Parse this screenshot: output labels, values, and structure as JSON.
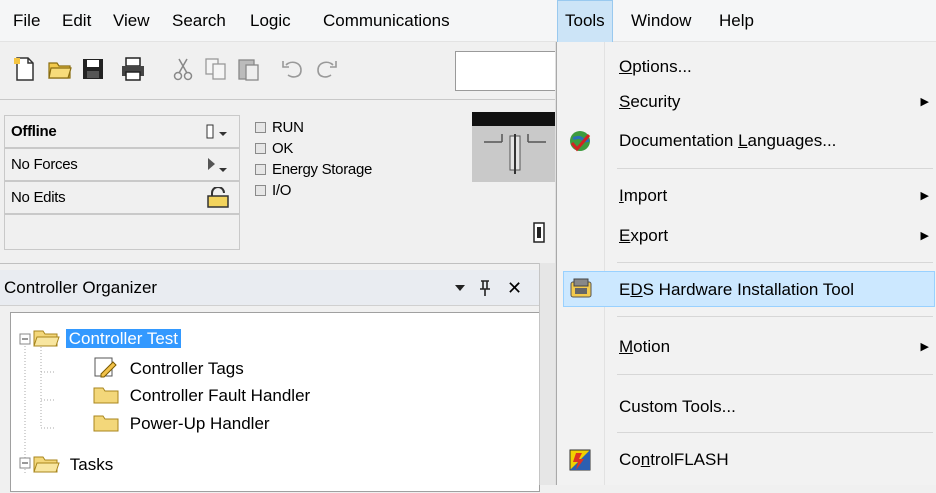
{
  "menubar": {
    "items": [
      "File",
      "Edit",
      "View",
      "Search",
      "Logic",
      "Communications",
      "Tools",
      "Window",
      "Help"
    ]
  },
  "status": {
    "rows": [
      "Offline",
      "No Forces",
      "No Edits"
    ],
    "checkboxes": [
      "RUN",
      "OK",
      "Energy Storage",
      "I/O"
    ]
  },
  "organizer": {
    "title": "Controller Organizer",
    "pin_glyph": "↑",
    "close_glyph": "✕",
    "tree": [
      {
        "label": "Controller Test"
      },
      {
        "label": "Controller Tags"
      },
      {
        "label": "Controller Fault Handler"
      },
      {
        "label": "Power-Up Handler"
      },
      {
        "label": "Tasks"
      }
    ]
  },
  "tools_menu": {
    "options": {
      "pre": "",
      "u": "O",
      "post": "ptions..."
    },
    "security": {
      "pre": "",
      "u": "S",
      "post": "ecurity"
    },
    "doc_lang": {
      "pre": "Documentation ",
      "u": "L",
      "post": "anguages..."
    },
    "import": {
      "pre": "",
      "u": "I",
      "post": "mport"
    },
    "export": {
      "pre": "",
      "u": "E",
      "post": "xport"
    },
    "eds": {
      "pre": "E",
      "u": "D",
      "post": "S Hardware Installation Tool"
    },
    "motion": {
      "pre": "",
      "u": "M",
      "post": "otion"
    },
    "custom": {
      "pre": "Custom Tools...",
      "u": "",
      "post": ""
    },
    "controlflash": {
      "pre": "Co",
      "u": "n",
      "post": "trolFLASH"
    },
    "submenu_arrow": "▶"
  }
}
